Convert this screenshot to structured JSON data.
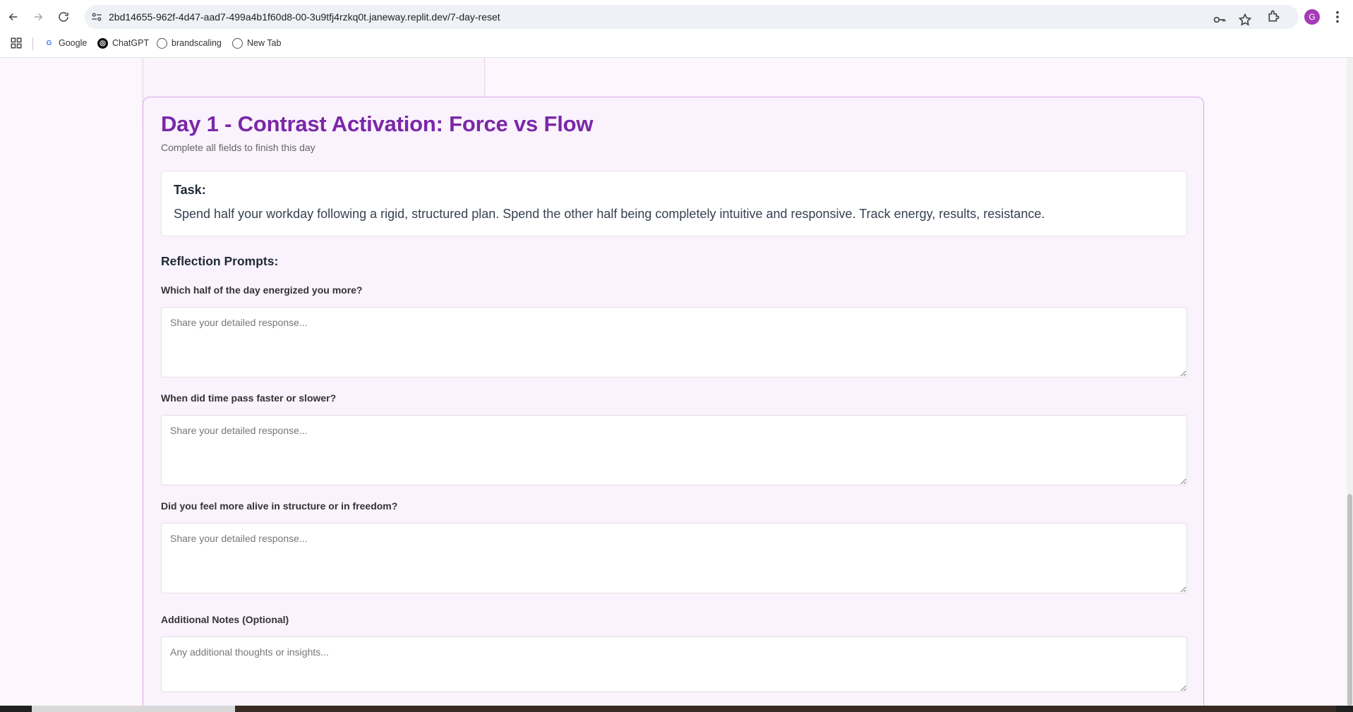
{
  "browser": {
    "url": "2bd14655-962f-4d47-aad7-499a4b1f60d8-00-3u9tfj4rzkq0t.janeway.replit.dev/7-day-reset",
    "profile_initial": "G",
    "bookmarks": [
      {
        "label": "Google",
        "icon": "google-icon"
      },
      {
        "label": "ChatGPT",
        "icon": "chatgpt-icon"
      },
      {
        "label": "brandscaling",
        "icon": "globe-icon"
      },
      {
        "label": "New Tab",
        "icon": "globe-icon"
      }
    ]
  },
  "day": {
    "title": "Day 1 - Contrast Activation: Force vs Flow",
    "subtitle": "Complete all fields to finish this day",
    "task_label": "Task:",
    "task_text": "Spend half your workday following a rigid, structured plan. Spend the other half being completely intuitive and responsive. Track energy, results, resistance.",
    "prompts_heading": "Reflection Prompts:",
    "prompts": [
      {
        "question": "Which half of the day energized you more?",
        "placeholder": "Share your detailed response..."
      },
      {
        "question": "When did time pass faster or slower?",
        "placeholder": "Share your detailed response..."
      },
      {
        "question": "Did you feel more alive in structure or in freedom?",
        "placeholder": "Share your detailed response..."
      }
    ],
    "notes_label": "Additional Notes (Optional)",
    "notes_placeholder": "Any additional thoughts or insights..."
  },
  "colors": {
    "accent": "#7a27a8",
    "card_border": "#d9a7e8",
    "card_bg": "#faf2fd"
  }
}
